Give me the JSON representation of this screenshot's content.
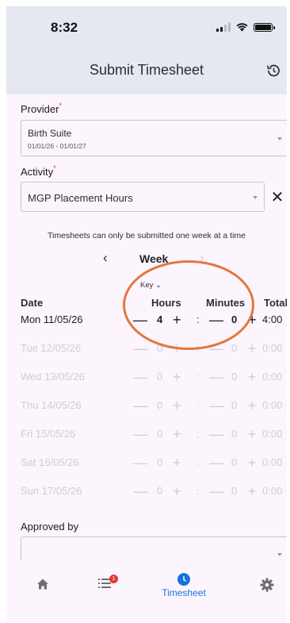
{
  "status_bar": {
    "time": "8:32"
  },
  "header": {
    "title": "Submit Timesheet"
  },
  "provider": {
    "label": "Provider",
    "required_mark": "*",
    "value": "Birth Suite",
    "date_range": "01/01/26 - 01/01/27"
  },
  "activity": {
    "label": "Activity",
    "required_mark": "*",
    "value": "MGP Placement Hours",
    "clear_glyph": "✕"
  },
  "notice": "Timesheets can only be submitted one week at a time",
  "week": {
    "prev_glyph": "‹",
    "label": "Week",
    "next_glyph": "›"
  },
  "key": {
    "label": "Key",
    "chevron": "⌄"
  },
  "table": {
    "headers": {
      "date": "Date",
      "hours": "Hours",
      "minutes": "Minutes",
      "total": "Total"
    },
    "minus": "—",
    "plus": "+",
    "sep": ":",
    "rows": [
      {
        "day": "Mon 11/05/26",
        "hours": "4",
        "minutes": "0",
        "total": "4:00",
        "enabled": true
      },
      {
        "day": "Tue  12/05/26",
        "hours": "0",
        "minutes": "0",
        "total": "0:00",
        "enabled": false
      },
      {
        "day": "Wed 13/05/26",
        "hours": "0",
        "minutes": "0",
        "total": "0:00",
        "enabled": false
      },
      {
        "day": "Thu  14/05/26",
        "hours": "0",
        "minutes": "0",
        "total": "0:00",
        "enabled": false
      },
      {
        "day": "Fri   15/05/26",
        "hours": "0",
        "minutes": "0",
        "total": "0:00",
        "enabled": false
      },
      {
        "day": "Sat  16/05/26",
        "hours": "0",
        "minutes": "0",
        "total": "0:00",
        "enabled": false
      },
      {
        "day": "Sun  17/05/26",
        "hours": "0",
        "minutes": "0",
        "total": "0:00",
        "enabled": false
      }
    ]
  },
  "approved_by": {
    "label": "Approved by",
    "value": ""
  },
  "bottom_nav": {
    "badge_count": "1",
    "timesheet_label": "Timesheet",
    "active_color": "#1a73d9"
  },
  "annotation_color": "#e3763b"
}
